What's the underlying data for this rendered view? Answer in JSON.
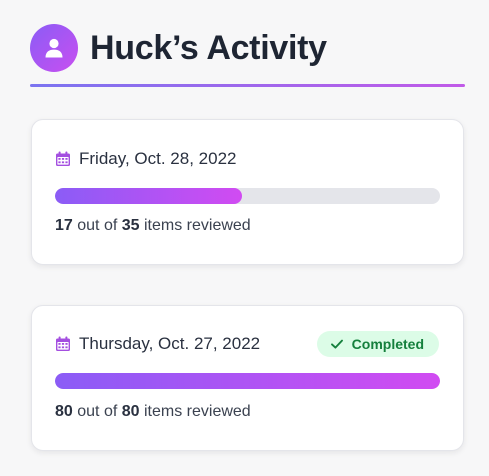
{
  "header": {
    "title": "Huck’s Activity",
    "avatar_icon": "user-icon",
    "accent_gradient": [
      "#8b5cf6",
      "#c84ff0"
    ]
  },
  "activities": [
    {
      "date": "Friday, Oct. 28, 2022",
      "icon": "calendar-icon",
      "reviewed": "17",
      "total": "35",
      "out_of_text": "out of",
      "items_text": "items reviewed",
      "progress_fraction": 0.4857,
      "completed": false
    },
    {
      "date": "Thursday, Oct. 27, 2022",
      "icon": "calendar-icon",
      "reviewed": "80",
      "total": "80",
      "out_of_text": "out of",
      "items_text": "items reviewed",
      "progress_fraction": 1.0,
      "completed": true,
      "badge_label": "Completed",
      "badge_icon": "check-icon",
      "badge_colors": {
        "background": "#dcfce7",
        "text": "#15803d"
      }
    }
  ],
  "colors": {
    "calendar_icon": "#a44fe0",
    "progress_track": "#e4e5ea",
    "progress_fill_start": "#8b5cf6",
    "progress_fill_end": "#d14bf2"
  }
}
